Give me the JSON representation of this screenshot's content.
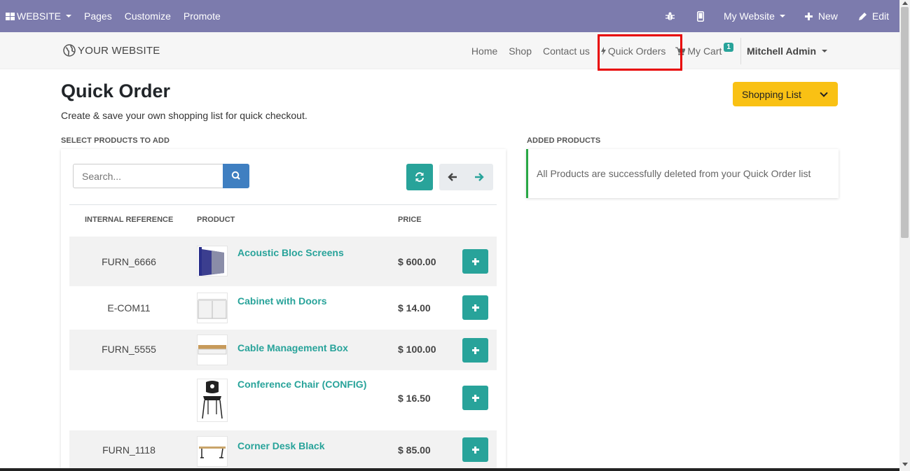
{
  "topbar": {
    "website_label": "WEBSITE",
    "items": [
      "Pages",
      "Customize",
      "Promote"
    ],
    "my_website_label": "My Website",
    "new_label": "New",
    "edit_label": "Edit",
    "bg_color": "#7c7bad"
  },
  "navbar": {
    "brand": "YOUR WEBSITE",
    "links": [
      "Home",
      "Shop",
      "Contact us"
    ],
    "quick_orders_label": "Quick Orders",
    "cart_label": "My Cart",
    "cart_count": "1",
    "user_label": "Mitchell Admin"
  },
  "page": {
    "title": "Quick Order",
    "subtitle": "Create & save your own shopping list for quick checkout.",
    "shopping_list_label": "Shopping List",
    "select_label": "SELECT PRODUCTS TO ADD",
    "added_label": "ADDED PRODUCTS",
    "added_message": "All Products are successfully deleted from your Quick Order list"
  },
  "search": {
    "placeholder": "Search..."
  },
  "table": {
    "headers": {
      "ref": "INTERNAL REFERENCE",
      "product": "PRODUCT",
      "price": "PRICE"
    },
    "rows": [
      {
        "ref": "FURN_6666",
        "name": "Acoustic Bloc Screens",
        "price": "$ 600.00",
        "icon": "acoustic-screen-image"
      },
      {
        "ref": "E-COM11",
        "name": "Cabinet with Doors",
        "price": "$ 14.00",
        "icon": "cabinet-image"
      },
      {
        "ref": "FURN_5555",
        "name": "Cable Management Box",
        "price": "$ 100.00",
        "icon": "cable-box-image"
      },
      {
        "ref": "",
        "name": "Conference Chair (CONFIG)",
        "price": "$ 16.50",
        "icon": "chair-image"
      },
      {
        "ref": "FURN_1118",
        "name": "Corner Desk Black",
        "price": "$ 85.00",
        "icon": "desk-image"
      }
    ]
  },
  "colors": {
    "accent": "#28a39a",
    "shopping_list": "#f9c114",
    "search_button": "#3f7fc1",
    "highlight": "#e80000"
  }
}
